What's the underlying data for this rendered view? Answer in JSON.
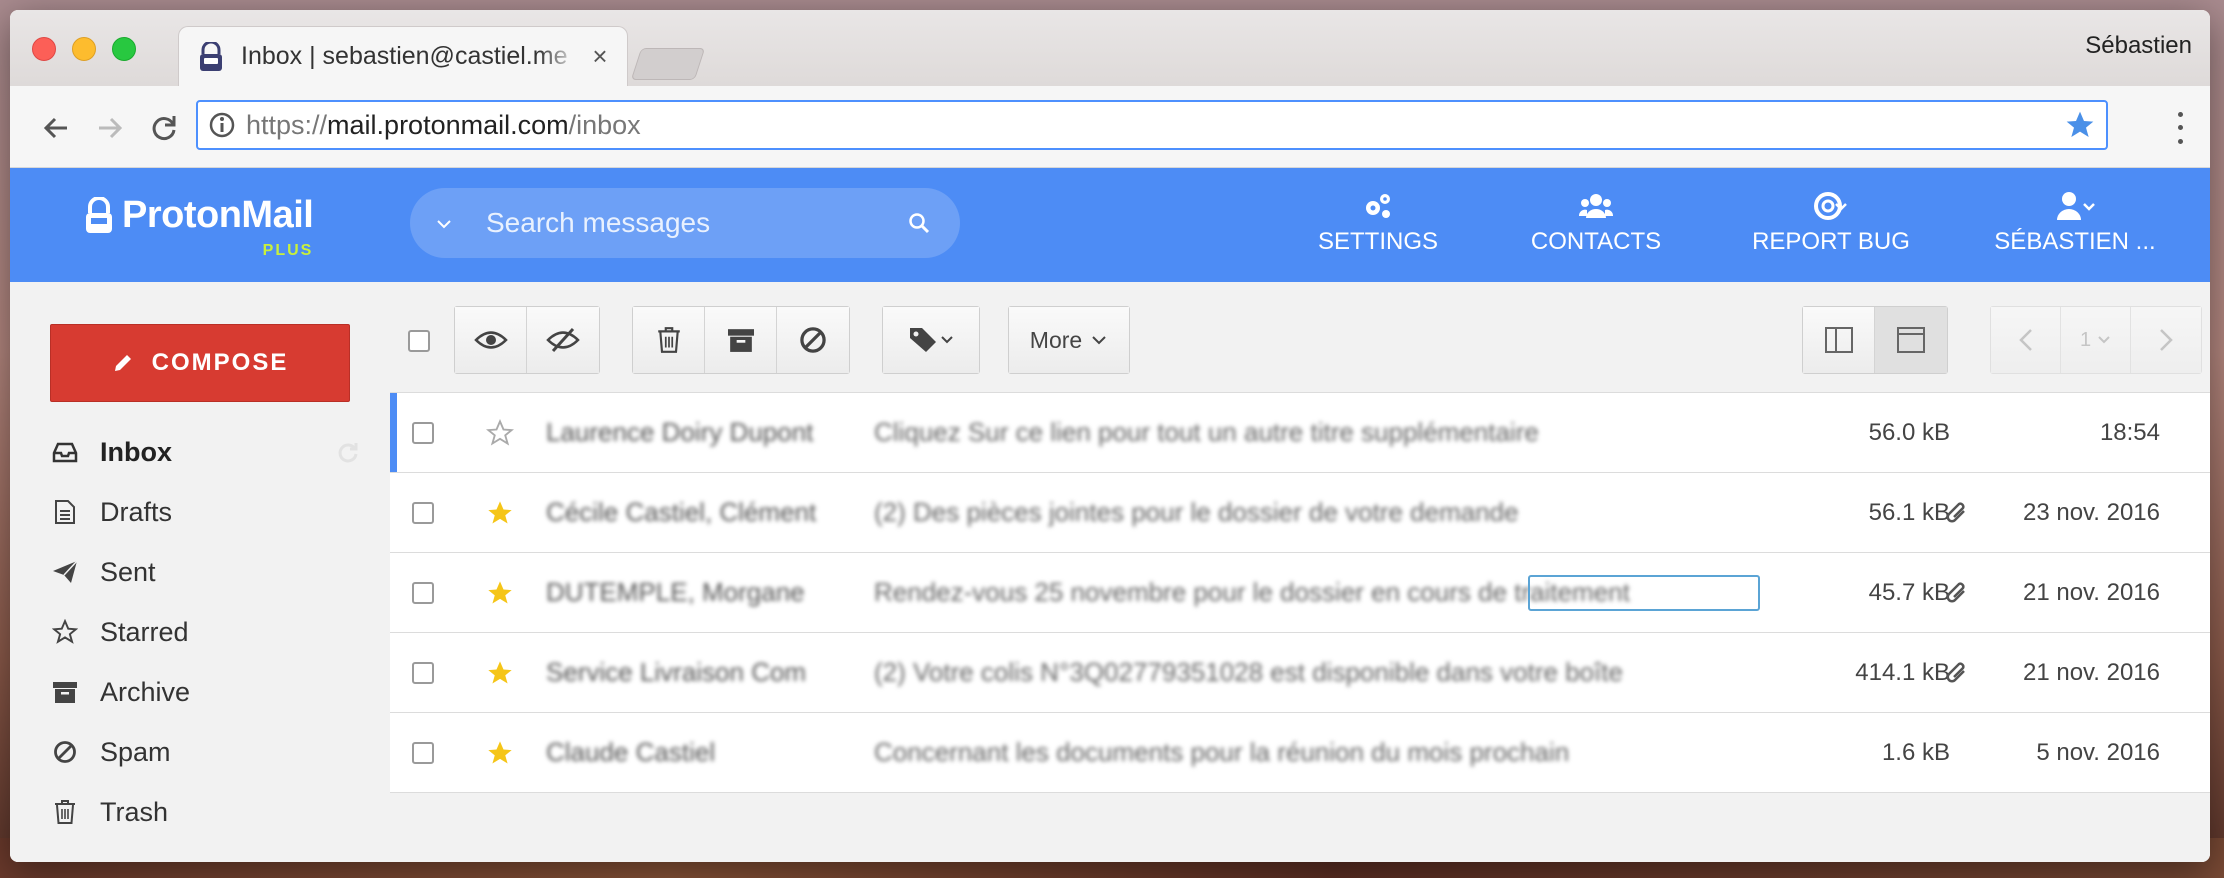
{
  "browser": {
    "tab_title": "Inbox | sebastien@castiel.me",
    "tab_close": "×",
    "profile_name": "Sébastien",
    "url_scheme": "https://",
    "url_host": "mail.protonmail.com",
    "url_path": "/inbox"
  },
  "header": {
    "brand": "ProtonMail",
    "plan": "PLUS",
    "search_placeholder": "Search messages",
    "nav": {
      "settings": "SETTINGS",
      "contacts": "CONTACTS",
      "report_bug": "REPORT BUG",
      "user": "SÉBASTIEN ..."
    }
  },
  "sidebar": {
    "compose": "COMPOSE",
    "folders": {
      "inbox": "Inbox",
      "drafts": "Drafts",
      "sent": "Sent",
      "starred": "Starred",
      "archive": "Archive",
      "spam": "Spam",
      "trash": "Trash"
    }
  },
  "toolbar": {
    "more": "More",
    "page": "1"
  },
  "messages": [
    {
      "sender": "Laurence Doiry Dupont",
      "subject": "Cliquez Sur ce lien pour tout un autre titre supplémentaire",
      "size": "56.0 kB",
      "date": "18:54",
      "starred": false,
      "attachment": false
    },
    {
      "sender": "Cécile Castiel, Clément",
      "subject": "(2) Des pièces jointes pour le dossier de votre demande",
      "size": "56.1 kB",
      "date": "23 nov. 2016",
      "starred": true,
      "attachment": true
    },
    {
      "sender": "DUTEMPLE, Morgane",
      "subject": "Rendez-vous 25 novembre pour le dossier en cours de traitement",
      "size": "45.7 kB",
      "date": "21 nov. 2016",
      "starred": true,
      "attachment": true
    },
    {
      "sender": "Service Livraison Com",
      "subject": "(2) Votre colis N°3Q02779351028 est disponible dans votre boîte",
      "size": "414.1 kB",
      "date": "21 nov. 2016",
      "starred": true,
      "attachment": true
    },
    {
      "sender": "Claude Castiel",
      "subject": "Concernant les documents pour la réunion du mois prochain",
      "size": "1.6 kB",
      "date": "5 nov. 2016",
      "starred": true,
      "attachment": false
    }
  ],
  "colors": {
    "brand_blue": "#4d8cf5",
    "compose_red": "#d73b31",
    "star_gold": "#f5c518",
    "plan_green": "#c8f03c"
  }
}
